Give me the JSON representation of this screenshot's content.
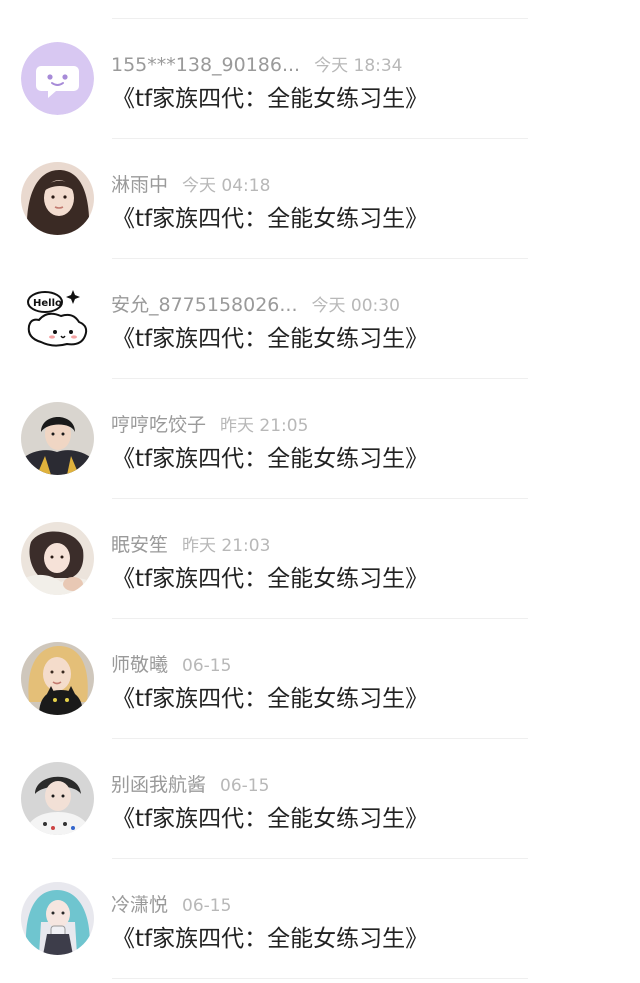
{
  "conversations": [
    {
      "name": "155***138_90186...",
      "time": "今天 18:34",
      "message": "《tf家族四代：全能女练习生》",
      "avatar_icon": "chat-bubble-icon",
      "avatar_color": "#d8c8f2"
    },
    {
      "name": "淋雨中",
      "time": "今天 04:18",
      "message": "《tf家族四代：全能女练习生》",
      "avatar_icon": "user-photo",
      "avatar_color": "#8a6a5a"
    },
    {
      "name": "安允_8775158026...",
      "time": "今天 00:30",
      "message": "《tf家族四代：全能女练习生》",
      "avatar_icon": "hello-sticker-icon",
      "avatar_color": "#ffffff"
    },
    {
      "name": "哼哼吃饺子",
      "time": "昨天 21:05",
      "message": "《tf家族四代：全能女练习生》",
      "avatar_icon": "user-photo",
      "avatar_color": "#3a3a3a"
    },
    {
      "name": "眠安笙",
      "time": "昨天 21:03",
      "message": "《tf家族四代：全能女练习生》",
      "avatar_icon": "user-photo",
      "avatar_color": "#c9b8b0"
    },
    {
      "name": "师敬曦",
      "time": "06-15",
      "message": "《tf家族四代：全能女练习生》",
      "avatar_icon": "user-photo",
      "avatar_color": "#e0c28a"
    },
    {
      "name": "别函我航酱",
      "time": "06-15",
      "message": "《tf家族四代：全能女练习生》",
      "avatar_icon": "user-photo",
      "avatar_color": "#b5b5b5"
    },
    {
      "name": "冷潇悦",
      "time": "06-15",
      "message": "《tf家族四代：全能女练习生》",
      "avatar_icon": "user-photo",
      "avatar_color": "#7fc6cf"
    }
  ]
}
